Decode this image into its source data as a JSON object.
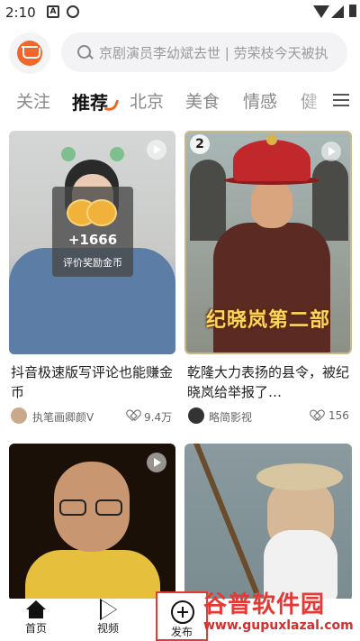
{
  "status_bar": {
    "time": "2:10",
    "icons": [
      "a-icon",
      "cloud-icon",
      "wifi-icon",
      "signal-icon",
      "battery-icon"
    ]
  },
  "header": {
    "search_placeholder": "京剧演员李幼斌去世 | 劳荣枝今天被执"
  },
  "tabs": [
    {
      "label": "关注",
      "active": false
    },
    {
      "label": "推荐",
      "active": true
    },
    {
      "label": "北京",
      "active": false
    },
    {
      "label": "美食",
      "active": false
    },
    {
      "label": "情感",
      "active": false
    },
    {
      "label": "健",
      "active": false
    }
  ],
  "feed": [
    {
      "title": "抖音极速版写评论也能赚金币",
      "author": "执笔画卿颜V",
      "likes": "9.4万",
      "reward": {
        "count": "+1666",
        "label": "评价奖励金币"
      }
    },
    {
      "badge": "2",
      "overlay": "纪晓岚第二部",
      "title": "乾隆大力表扬的县令，被纪晓岚给举报了…",
      "author": "略简影视",
      "likes": "156"
    },
    {
      "title": ""
    },
    {
      "title": ""
    }
  ],
  "bottom_nav": [
    {
      "label": "首页",
      "icon": "home-icon"
    },
    {
      "label": "视频",
      "icon": "play-icon"
    },
    {
      "label": "发布",
      "icon": "plus-circle-icon"
    }
  ],
  "watermark": {
    "title": "谷普软件园",
    "url": "www.gupuxlazal.com"
  },
  "colors": {
    "accent": "#f26522",
    "logo": "#f2662b",
    "highlight_border": "#e53935"
  }
}
